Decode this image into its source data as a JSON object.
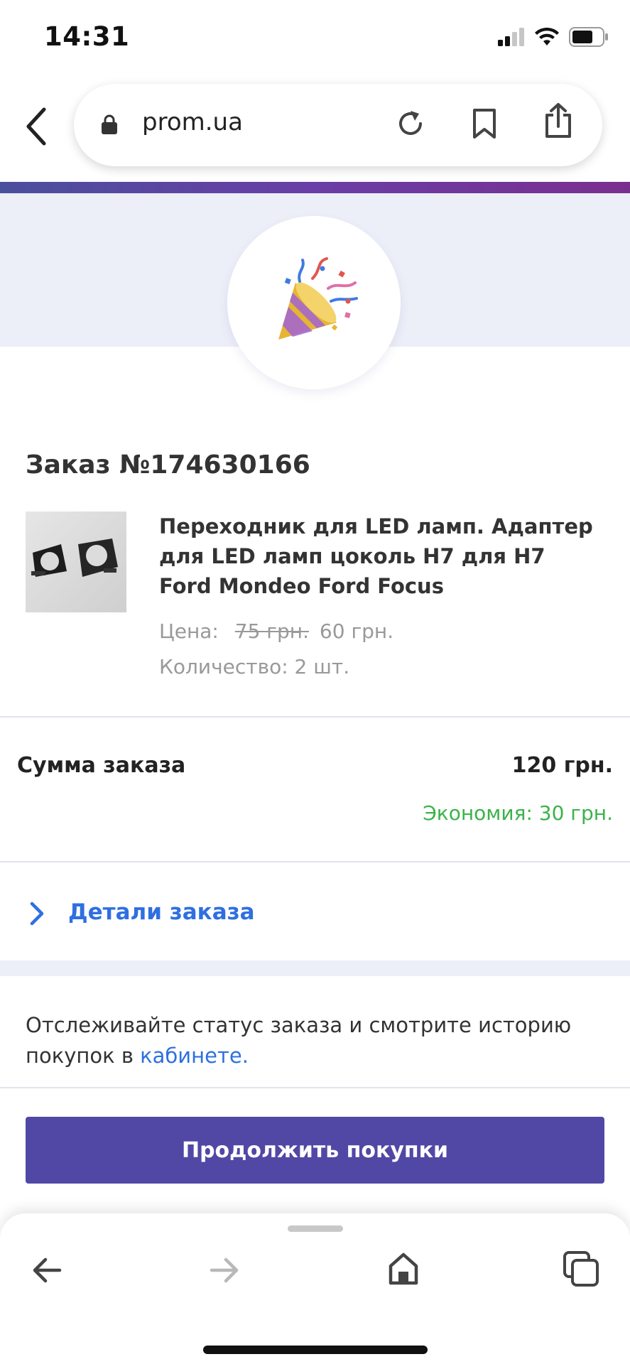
{
  "status_bar": {
    "time": "14:31",
    "icons": [
      "signal-icon",
      "wifi-icon",
      "battery-icon"
    ]
  },
  "browser": {
    "url": "prom.ua",
    "icons": [
      "back-chevron-icon",
      "lock-icon",
      "reload-icon",
      "bookmark-icon",
      "share-icon"
    ]
  },
  "order": {
    "title": "Заказ №174630166",
    "product": {
      "name": "Переходник для LED ламп. Адаптер для LED ламп цоколь H7 для H7 Ford Mondeo Ford Focus",
      "price_label": "Цена:",
      "price_old": "75 грн.",
      "price_new": "60 грн.",
      "quantity": "Количество: 2 шт."
    },
    "sum_label": "Сумма заказа",
    "sum_value": "120 грн.",
    "savings": "Экономия: 30 грн.",
    "details_label": "Детали заказа"
  },
  "tracking": {
    "text": "Отслеживайте статус заказа и смотрите историю покупок в ",
    "link": "кабинете."
  },
  "continue_button": "Продолжить покупки",
  "colors": {
    "accent": "#5148a5",
    "link": "#2f6fe0",
    "savings": "#3bb34a",
    "hero_bg": "#eceef8"
  },
  "toolbar": {
    "icons": [
      "arrow-left-icon",
      "arrow-right-icon",
      "home-icon",
      "tabs-icon"
    ]
  }
}
